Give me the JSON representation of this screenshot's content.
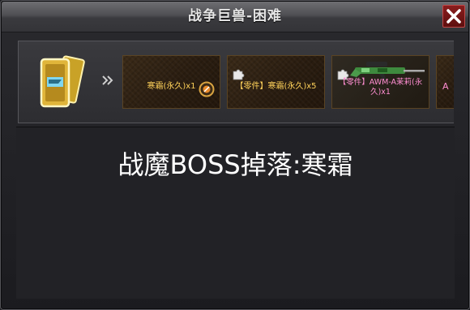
{
  "window": {
    "title": "战争巨兽-困难",
    "close_icon": "close-x-icon"
  },
  "rewards": {
    "card_icon": "golden-card-stack-icon",
    "arrow_icon": "double-chevron-right-icon",
    "items": [
      {
        "label": "寒霜(永久)x1",
        "color": "#ffd25a",
        "icon": "medal-icon"
      },
      {
        "label": "【零件】寒霜(永久)x5",
        "color": "#ffd25a",
        "icon": "puzzle-piece-icon"
      },
      {
        "label": "【零件】AWM-A茉莉(永久)x1",
        "color": "#ff8ed2",
        "icon": "sniper-rifle-icon"
      },
      {
        "label": "A",
        "color": "#ff8ed2"
      }
    ]
  },
  "content": {
    "drop_text": "战魔BOSS掉落:寒霜"
  }
}
